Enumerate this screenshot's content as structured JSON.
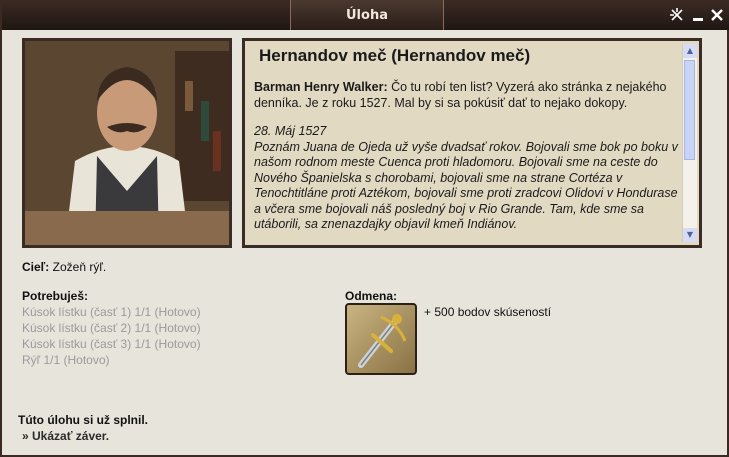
{
  "window": {
    "title": "Úloha",
    "controls": {
      "pin_icon": "pin-icon",
      "minimize_icon": "minimize-icon",
      "close_icon": "close-icon"
    }
  },
  "quest": {
    "title": "Hernandov meč (Hernandov meč)",
    "speaker": "Barman Henry Walker:",
    "speech": " Čo tu robí ten list? Vyzerá ako stránka z nejakého denníka. Je z roku 1527. Mal by si sa pokúsiť dať to nejako dokopy.",
    "diary_date": "28. Máj 1527",
    "diary_text": "Poznám Juana de Ojeda už vyše dvadsať rokov. Bojovali sme bok po boku v našom rodnom meste Cuenca proti hladomoru. Bojovali sme na ceste do Nového Španielska s chorobami, bojovali sme na strane Cortéza v Tenochtitláne proti Aztékom, bojovali sme proti zradcovi Olidovi v Hondurase a včera sme bojovali náš posledný boj v Rio Grande. Tam, kde sme sa utáborili, sa znenazdajky objavil kmeň Indiánov."
  },
  "goal": {
    "label": "Cieľ:",
    "text": "Zožeň rýľ."
  },
  "needs": {
    "label": "Potrebuješ:",
    "items": [
      "Kúsok lístku (časť 1) 1/1 (Hotovo)",
      "Kúsok lístku (časť 2) 1/1 (Hotovo)",
      "Kúsok lístku (časť 3) 1/1 (Hotovo)",
      "Rýľ 1/1 (Hotovo)"
    ]
  },
  "reward": {
    "label": "Odmena:",
    "text": "+ 500 bodov skúseností",
    "icon": "sword-icon"
  },
  "footer": {
    "done": "Túto úlohu si už splnil.",
    "link": "» Ukázať záver."
  },
  "colors": {
    "frame": "#2e2019",
    "background": "#e7e4dc",
    "textbox": "#e2d9c2",
    "muted": "#9a9a9a"
  }
}
